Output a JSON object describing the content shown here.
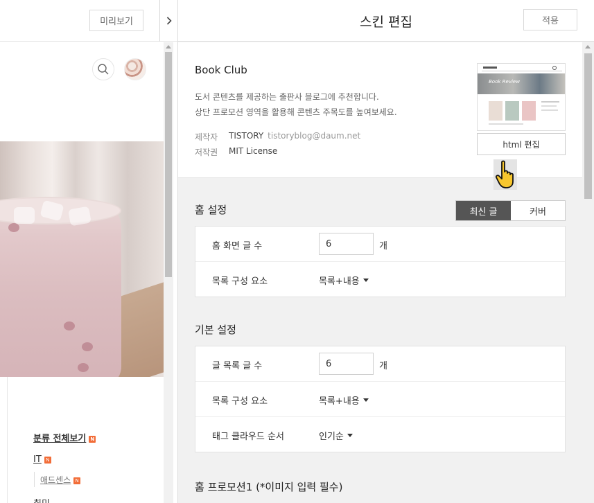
{
  "left_pane": {
    "preview_label": "미리보기",
    "categories": {
      "all": "분류 전체보기",
      "it": "IT",
      "adsense": "애드센스",
      "hobby": "취미",
      "new_badge": "N"
    }
  },
  "editor": {
    "title": "스킨 편집",
    "apply_label": "적용",
    "skin": {
      "name": "Book Club",
      "desc_line1": "도서 콘텐츠를 제공하는 출판사 블로그에 추천합니다.",
      "desc_line2": "상단 프로모션 영역을 활용해 콘텐츠 주목도를 높여보세요.",
      "maker_label": "제작자",
      "maker_value": "TISTORY",
      "maker_email": "tistoryblog@daum.net",
      "license_label": "저작권",
      "license_value": "MIT License",
      "thumb_caption": "Book Review",
      "html_edit_label": "html 편집"
    },
    "home_settings": {
      "title": "홈 설정",
      "toggle": [
        "최신 글",
        "커버"
      ],
      "toggle_selected": "최신 글",
      "rows": {
        "post_count_label": "홈 화면 글 수",
        "post_count_value": "6",
        "unit": "개",
        "list_layout_label": "목록 구성 요소",
        "list_layout_value": "목록+내용"
      }
    },
    "basic_settings": {
      "title": "기본 설정",
      "rows": {
        "post_count_label": "글 목록 글 수",
        "post_count_value": "6",
        "unit": "개",
        "list_layout_label": "목록 구성 요소",
        "list_layout_value": "목록+내용",
        "tag_order_label": "태그 클라우드 순서",
        "tag_order_value": "인기순"
      }
    },
    "promo1": {
      "title": "홈 프로모션1 (*이미지 입력 필수)"
    }
  },
  "colors": {
    "accent_dark": "#555555",
    "badge": "#f26d38"
  }
}
